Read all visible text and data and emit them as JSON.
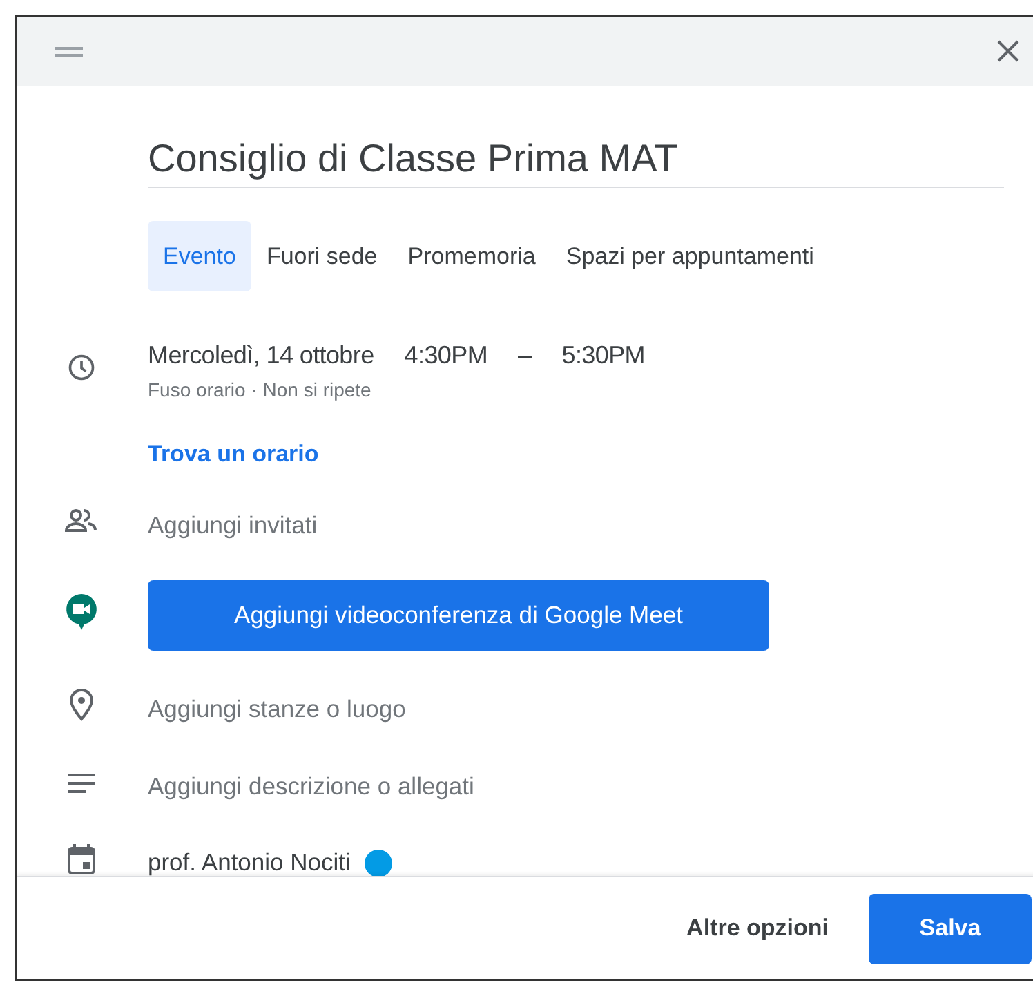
{
  "title": "Consiglio di Classe Prima MAT",
  "tabs": [
    {
      "label": "Evento",
      "selected": true
    },
    {
      "label": "Fuori sede",
      "selected": false
    },
    {
      "label": "Promemoria",
      "selected": false
    },
    {
      "label": "Spazi per appuntamenti",
      "selected": false
    }
  ],
  "when": {
    "date": "Mercoledì, 14 ottobre",
    "start": "4:30PM",
    "dash": "–",
    "end": "5:30PM",
    "details": "Fuso orario · Non si ripete",
    "link": "Trova un orario"
  },
  "rows": [
    {
      "kind": "guests",
      "label": "Aggiungi invitati"
    },
    {
      "kind": "meet",
      "label": "Aggiungi videoconferenza di Google Meet"
    },
    {
      "kind": "location",
      "label": "Aggiungi stanze o luogo"
    },
    {
      "kind": "description",
      "label": "Aggiungi descrizione o allegati"
    },
    {
      "kind": "calendar",
      "label": "prof. Antonio Nociti",
      "color": "#039be5"
    }
  ],
  "footer": [
    {
      "kind": "text",
      "label": "Altre opzioni"
    },
    {
      "kind": "primary",
      "label": "Salva"
    }
  ]
}
